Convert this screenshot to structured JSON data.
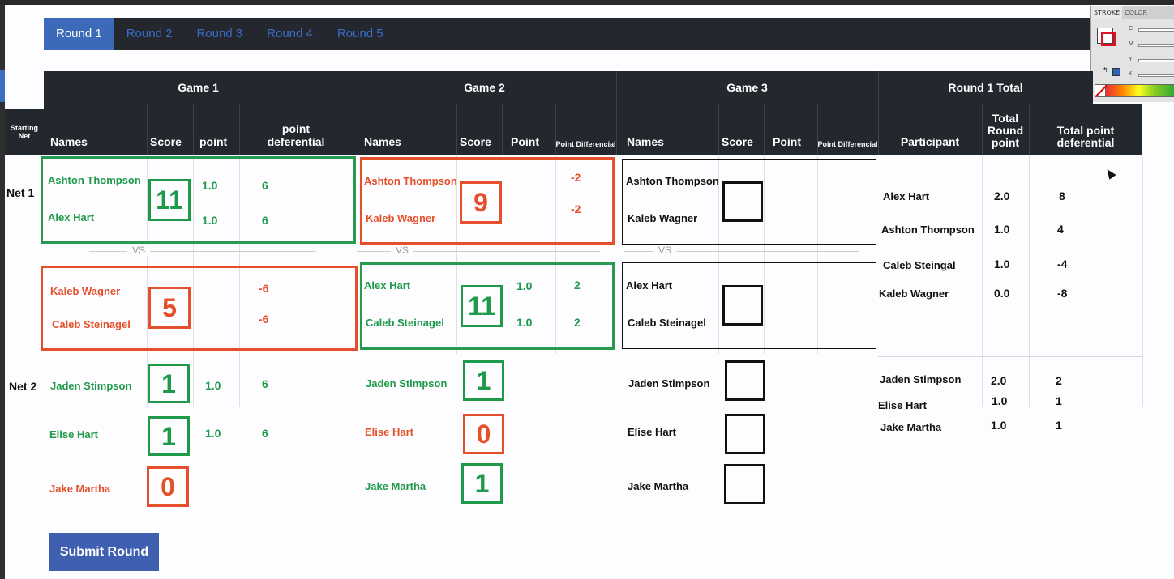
{
  "tabs": [
    {
      "label": "Round 1",
      "active": true
    },
    {
      "label": "Round 2",
      "active": false
    },
    {
      "label": "Round 3",
      "active": false
    },
    {
      "label": "Round 4",
      "active": false
    },
    {
      "label": "Round 5",
      "active": false
    }
  ],
  "swatch_panel": {
    "tab_stroke": "STROKE",
    "tab_color": "COLOR",
    "sliders": [
      "C",
      "M",
      "Y",
      "K"
    ]
  },
  "headers": {
    "game1": "Game 1",
    "game2": "Game 2",
    "game3": "Game 3",
    "round_total": "Round 1 Total",
    "starting_net": "Starting Net",
    "names": "Names",
    "score": "Score",
    "point_lower": "point",
    "point_upper": "Point",
    "point_deferential": "point deferential",
    "point_differencial": "Point Differencial",
    "participant": "Participant",
    "total_round_point": "Total Round point",
    "total_point_deferential": "Total point deferential"
  },
  "colors": {
    "win": "#1e9a4a",
    "lose": "#e5502a",
    "pending": "#111111",
    "header_bg": "#23282e",
    "tab_active": "#3d69b9"
  },
  "vs_label": "VS",
  "net1": {
    "label": "Net 1",
    "game1": {
      "top": {
        "names": [
          "Ashton Thompson",
          "Alex Hart"
        ],
        "score": "11",
        "points": [
          "1.0",
          "1.0"
        ],
        "diffs": [
          "6",
          "6"
        ]
      },
      "bottom": {
        "names": [
          "Kaleb Wagner",
          "Caleb Steinagel"
        ],
        "score": "5",
        "diffs": [
          "-6",
          "-6"
        ]
      }
    },
    "game2": {
      "top": {
        "names": [
          "Ashton Thompson",
          "Kaleb Wagner"
        ],
        "score": "9",
        "diffs": [
          "-2",
          "-2"
        ]
      },
      "bottom": {
        "names": [
          "Alex Hart",
          "Caleb Steinagel"
        ],
        "score": "11",
        "points": [
          "1.0",
          "1.0"
        ],
        "diffs": [
          "2",
          "2"
        ]
      }
    },
    "game3": {
      "top": {
        "names": [
          "Ashton Thompson",
          "Kaleb Wagner"
        ]
      },
      "bottom": {
        "names": [
          "Alex Hart",
          "Caleb Steinagel"
        ]
      }
    },
    "totals": [
      {
        "name": "Alex Hart",
        "points": "2.0",
        "diff": "8"
      },
      {
        "name": "Ashton Thompson",
        "points": "1.0",
        "diff": "4"
      },
      {
        "name": "Caleb Steingal",
        "points": "1.0",
        "diff": "-4"
      },
      {
        "name": "Kaleb Wagner",
        "points": "0.0",
        "diff": "-8"
      }
    ]
  },
  "net2": {
    "label": "Net 2",
    "game1": [
      {
        "name": "Jaden Stimpson",
        "score": "1",
        "point": "1.0",
        "diff": "6"
      },
      {
        "name": "Elise Hart",
        "score": "1",
        "point": "1.0",
        "diff": "6"
      },
      {
        "name": "Jake Martha",
        "score": "0"
      }
    ],
    "game2": [
      {
        "name": "Jaden Stimpson",
        "score": "1"
      },
      {
        "name": "Elise Hart",
        "score": "0"
      },
      {
        "name": "Jake Martha",
        "score": "1"
      }
    ],
    "game3": [
      {
        "name": "Jaden Stimpson"
      },
      {
        "name": "Elise Hart"
      },
      {
        "name": "Jake Martha"
      }
    ],
    "totals": [
      {
        "name": "Jaden Stimpson",
        "points": "2.0",
        "diff": "2"
      },
      {
        "name": "Elise Hart",
        "points": "1.0",
        "diff": "1"
      },
      {
        "name": "Jake Martha",
        "points": "1.0",
        "diff": "1"
      }
    ]
  },
  "submit_label": "Submit Round"
}
